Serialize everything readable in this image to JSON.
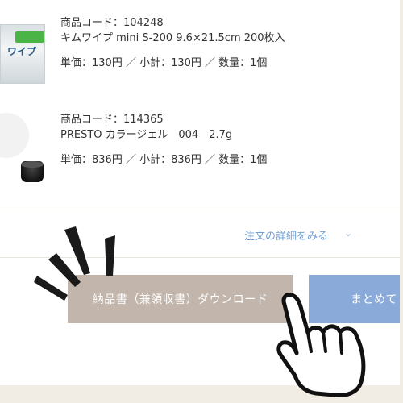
{
  "items": [
    {
      "code_line": "商品コード：104248",
      "name": "キムワイプ mini S-200 9.6×21.5cm 200枚入",
      "price_line": "単価：130円 ／ 小計：130円 ／ 数量：1個",
      "thumb_text": "ワイプ"
    },
    {
      "code_line": "商品コード：114365",
      "name": "PRESTO カラージェル　004　2.7g",
      "price_line": "単価：836円 ／ 小計：836円 ／ 数量：1個"
    }
  ],
  "detail_link": "注文の詳細をみる",
  "buttons": {
    "download": "納品書（兼領収書）ダウンロード",
    "bulk": "まとめて"
  },
  "icons": {
    "chevron": "chevron-down-icon",
    "pointer": "hand-pointer-icon"
  },
  "colors": {
    "accent_link": "#6f9ed3",
    "download_button": "#c2b6ac",
    "bulk_button": "#8aabd9"
  }
}
